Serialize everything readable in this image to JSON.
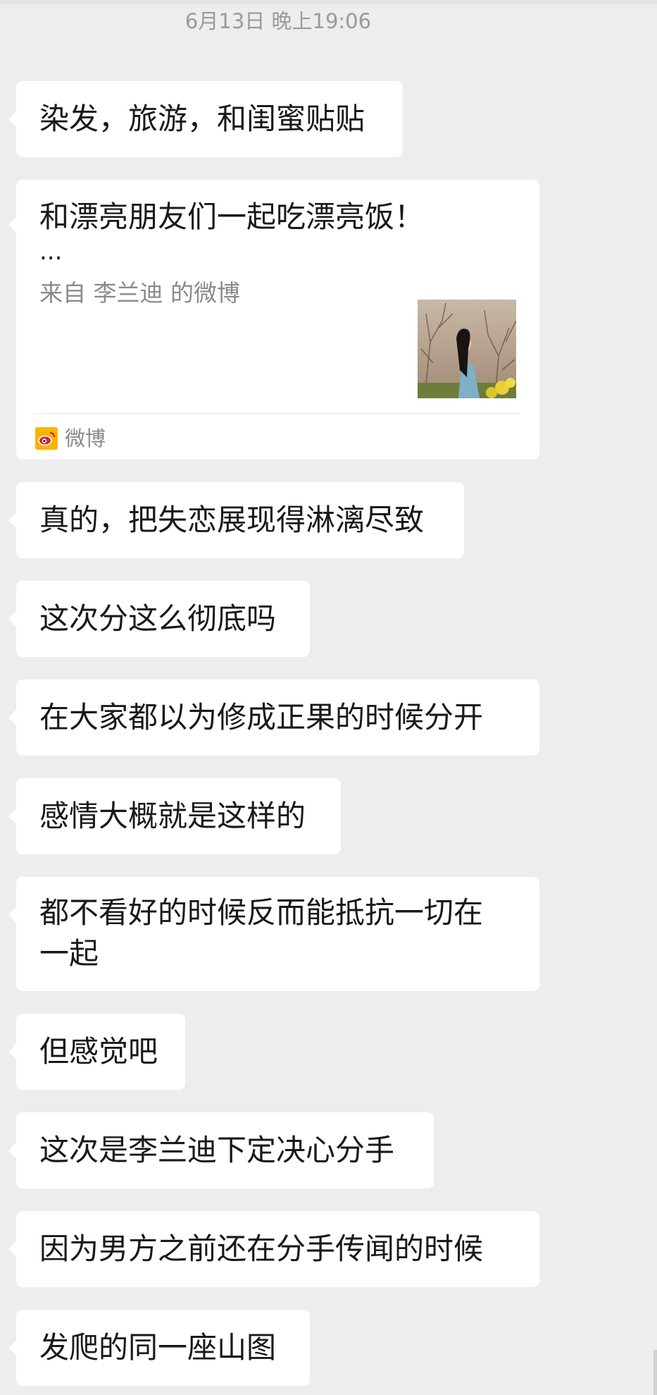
{
  "chat": {
    "timestamp": "6月13日 晚上19:06",
    "messages": [
      {
        "text": "染发，旅游，和闺蜜贴贴"
      },
      {
        "text": "真的，把失恋展现得淋漓尽致"
      },
      {
        "text": "这次分这么彻底吗"
      },
      {
        "text": "在大家都以为修成正果的时候分开"
      },
      {
        "text": "感情大概就是这样的"
      },
      {
        "text": "都不看好的时候反而能抵抗一切在\n一起"
      },
      {
        "text": "但感觉吧"
      },
      {
        "text": "这次是李兰迪下定决心分手"
      },
      {
        "text": "因为男方之前还在分手传闻的时候"
      },
      {
        "text": "发爬的同一座山图"
      }
    ],
    "share_card": {
      "title": "和漂亮朋友们一起吃漂亮饭！",
      "ellipsis": "...",
      "source": "来自 李兰迪 的微博",
      "app_name": "微博",
      "app_icon": "weibo-icon"
    }
  },
  "colors": {
    "background": "#ededed",
    "bubble": "#ffffff",
    "text": "#191919",
    "muted": "#8a8a8a",
    "weibo_accent": "#f7b500"
  }
}
